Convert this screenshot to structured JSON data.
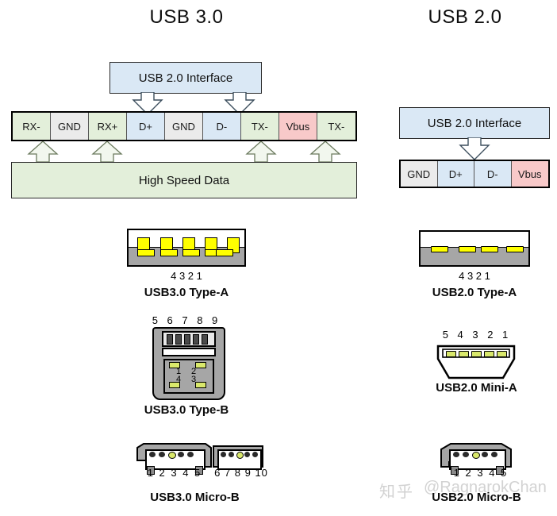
{
  "columns": {
    "left_title": "USB 3.0",
    "right_title": "USB 2.0"
  },
  "usb3": {
    "interface_label": "USB 2.0 Interface",
    "pins": [
      {
        "label": "RX-",
        "color": "#e3efda"
      },
      {
        "label": "GND",
        "color": "#ebebeb"
      },
      {
        "label": "RX+",
        "color": "#e3efda"
      },
      {
        "label": "D+",
        "color": "#dae8f5"
      },
      {
        "label": "GND",
        "color": "#ebebeb"
      },
      {
        "label": "D-",
        "color": "#dae8f5"
      },
      {
        "label": "TX-",
        "color": "#e3efda"
      },
      {
        "label": "Vbus",
        "color": "#f8c9c9"
      },
      {
        "label": "TX-",
        "color": "#e3efda"
      }
    ],
    "high_speed_label": "High Speed Data"
  },
  "usb2": {
    "interface_label": "USB 2.0 Interface",
    "pins": [
      {
        "label": "GND",
        "color": "#ebebeb"
      },
      {
        "label": "D+",
        "color": "#dae8f5"
      },
      {
        "label": "D-",
        "color": "#dae8f5"
      },
      {
        "label": "Vbus",
        "color": "#f8c9c9"
      }
    ]
  },
  "connectors": {
    "usb3_type_a": {
      "caption": "USB3.0 Type-A",
      "pin_numbers": "4   3   2   1",
      "contact_count": 5
    },
    "usb2_type_a": {
      "caption": "USB2.0 Type-A",
      "pin_numbers": "4   3   2   1",
      "contact_count": 4
    },
    "usb3_type_b": {
      "caption": "USB3.0 Type-B",
      "top_pin_numbers": "5 6 7 8 9",
      "inner_pin_numbers": [
        "1",
        "2",
        "3",
        "4"
      ]
    },
    "usb2_mini_a": {
      "caption": "USB2.0 Mini-A",
      "pin_numbers": "5 4 3 2 1"
    },
    "usb3_micro_b": {
      "caption": "USB3.0 Micro-B",
      "left_pin_numbers": "1 2 3 4 5",
      "right_pin_numbers": "6 7 8 9 10"
    },
    "usb2_micro_b": {
      "caption": "USB2.0 Micro-B",
      "pin_numbers": "1 2 3 4 5"
    }
  },
  "watermark": {
    "logo": "知乎",
    "handle": "@RagnarokChan"
  },
  "theme": {
    "green": "#e3efda",
    "blue": "#dae8f5",
    "gray": "#ebebeb",
    "red": "#f8c9c9",
    "metal": "#a6a6a6",
    "contact_yellow": "#ffff00",
    "contact_olive": "#d9e86b",
    "outline": "#000000"
  }
}
